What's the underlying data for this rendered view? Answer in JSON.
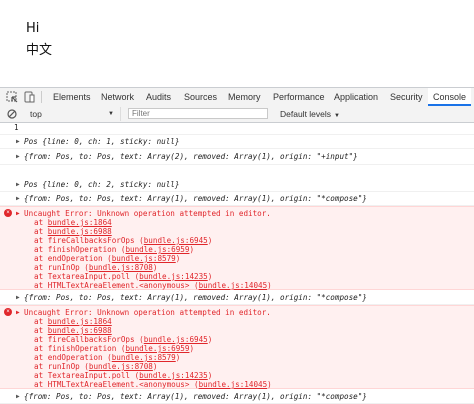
{
  "page": {
    "line1": "Hi",
    "line2": "中文"
  },
  "devtools": {
    "tabs": [
      "Elements",
      "Network",
      "Audits",
      "Sources",
      "Memory",
      "Performance",
      "Application",
      "Security",
      "Console"
    ],
    "active_tab": "Console",
    "toolbar": {
      "context": "top",
      "filter_placeholder": "Filter",
      "levels": "Default levels"
    }
  },
  "console": {
    "line_number": "1",
    "entries": [
      {
        "type": "log",
        "text": "Pos {line: 0, ch: 1, sticky: null}"
      },
      {
        "type": "log",
        "text": "{from: Pos, to: Pos, text: Array(2), removed: Array(1), origin: \"+input\"}"
      },
      {
        "type": "log",
        "text": "Pos {line: 0, ch: 2, sticky: null}"
      },
      {
        "type": "log",
        "text": "{from: Pos, to: Pos, text: Array(1), removed: Array(1), origin: \"*compose\"}"
      },
      {
        "type": "error",
        "message": "Uncaught Error: Unknown operation attempted in editor.",
        "stack": [
          {
            "fn": "at ",
            "loc": "bundle.js:1864"
          },
          {
            "fn": "at ",
            "loc": "bundle.js:6988"
          },
          {
            "fn": "at fireCallbacksForOps (",
            "loc": "bundle.js:6945",
            "end": ")"
          },
          {
            "fn": "at finishOperation (",
            "loc": "bundle.js:6959",
            "end": ")"
          },
          {
            "fn": "at endOperation (",
            "loc": "bundle.js:8579",
            "end": ")"
          },
          {
            "fn": "at runInOp (",
            "loc": "bundle.js:8708",
            "end": ")"
          },
          {
            "fn": "at TextareaInput.poll (",
            "loc": "bundle.js:14235",
            "end": ")"
          },
          {
            "fn": "at HTMLTextAreaElement.<anonymous> (",
            "loc": "bundle.js:14045",
            "end": ")"
          }
        ]
      },
      {
        "type": "log",
        "text": "{from: Pos, to: Pos, text: Array(1), removed: Array(1), origin: \"*compose\"}"
      },
      {
        "type": "error",
        "message": "Uncaught Error: Unknown operation attempted in editor.",
        "stack": [
          {
            "fn": "at ",
            "loc": "bundle.js:1864"
          },
          {
            "fn": "at ",
            "loc": "bundle.js:6988"
          },
          {
            "fn": "at fireCallbacksForOps (",
            "loc": "bundle.js:6945",
            "end": ")"
          },
          {
            "fn": "at finishOperation (",
            "loc": "bundle.js:6959",
            "end": ")"
          },
          {
            "fn": "at endOperation (",
            "loc": "bundle.js:8579",
            "end": ")"
          },
          {
            "fn": "at runInOp (",
            "loc": "bundle.js:8708",
            "end": ")"
          },
          {
            "fn": "at TextareaInput.poll (",
            "loc": "bundle.js:14235",
            "end": ")"
          },
          {
            "fn": "at HTMLTextAreaElement.<anonymous> (",
            "loc": "bundle.js:14045",
            "end": ")"
          }
        ]
      },
      {
        "type": "log",
        "text": "{from: Pos, to: Pos, text: Array(1), removed: Array(1), origin: \"*compose\"}"
      }
    ]
  },
  "colors": {
    "error": "#e0262b",
    "error_bg": "#fff0f0",
    "toolbar_bg": "#f3f3f3",
    "active_tab_underline": "#1a73e8"
  }
}
